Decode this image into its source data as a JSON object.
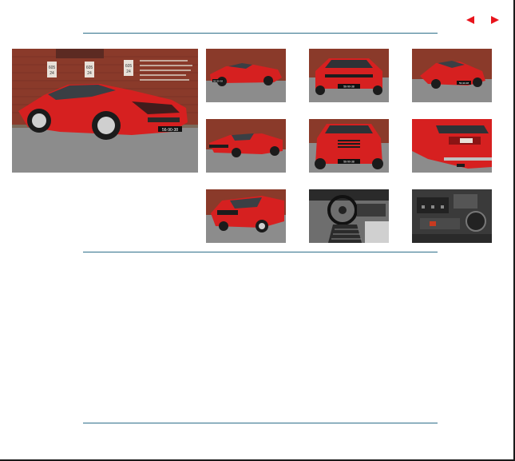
{
  "navigation": {
    "prev_icon": "triangle-left-icon",
    "next_icon": "triangle-right-icon",
    "accent_color": "#e8141c"
  },
  "rules": {
    "color": "#2e6f8a"
  },
  "main_photo": {
    "subject": "red-sports-car-front-three-quarter",
    "wall_text": [
      "605",
      "24",
      "605",
      "24",
      "605",
      "24"
    ],
    "plate": "56-90-38"
  },
  "gallery": {
    "thumbnails": [
      {
        "subject": "car-front-left-red",
        "plate": "56-90-38"
      },
      {
        "subject": "car-front-on-red",
        "plate": "56-90-38"
      },
      {
        "subject": "car-front-right-red",
        "plate": "56-90-38"
      },
      {
        "subject": "car-rear-left-red",
        "plate": ""
      },
      {
        "subject": "car-front-bonnet-red",
        "plate": "56-90-38"
      },
      {
        "subject": "car-rear-closeup-red",
        "plate": ""
      },
      {
        "subject": "car-rear-quarter-red",
        "plate": ""
      },
      {
        "subject": "car-interior-steering-wheel",
        "plate": ""
      },
      {
        "subject": "car-engine-bay",
        "plate": ""
      }
    ]
  },
  "colors": {
    "car_red": "#d62020",
    "brick": "#8a3a2a",
    "tarmac": "#8c8c8c"
  }
}
